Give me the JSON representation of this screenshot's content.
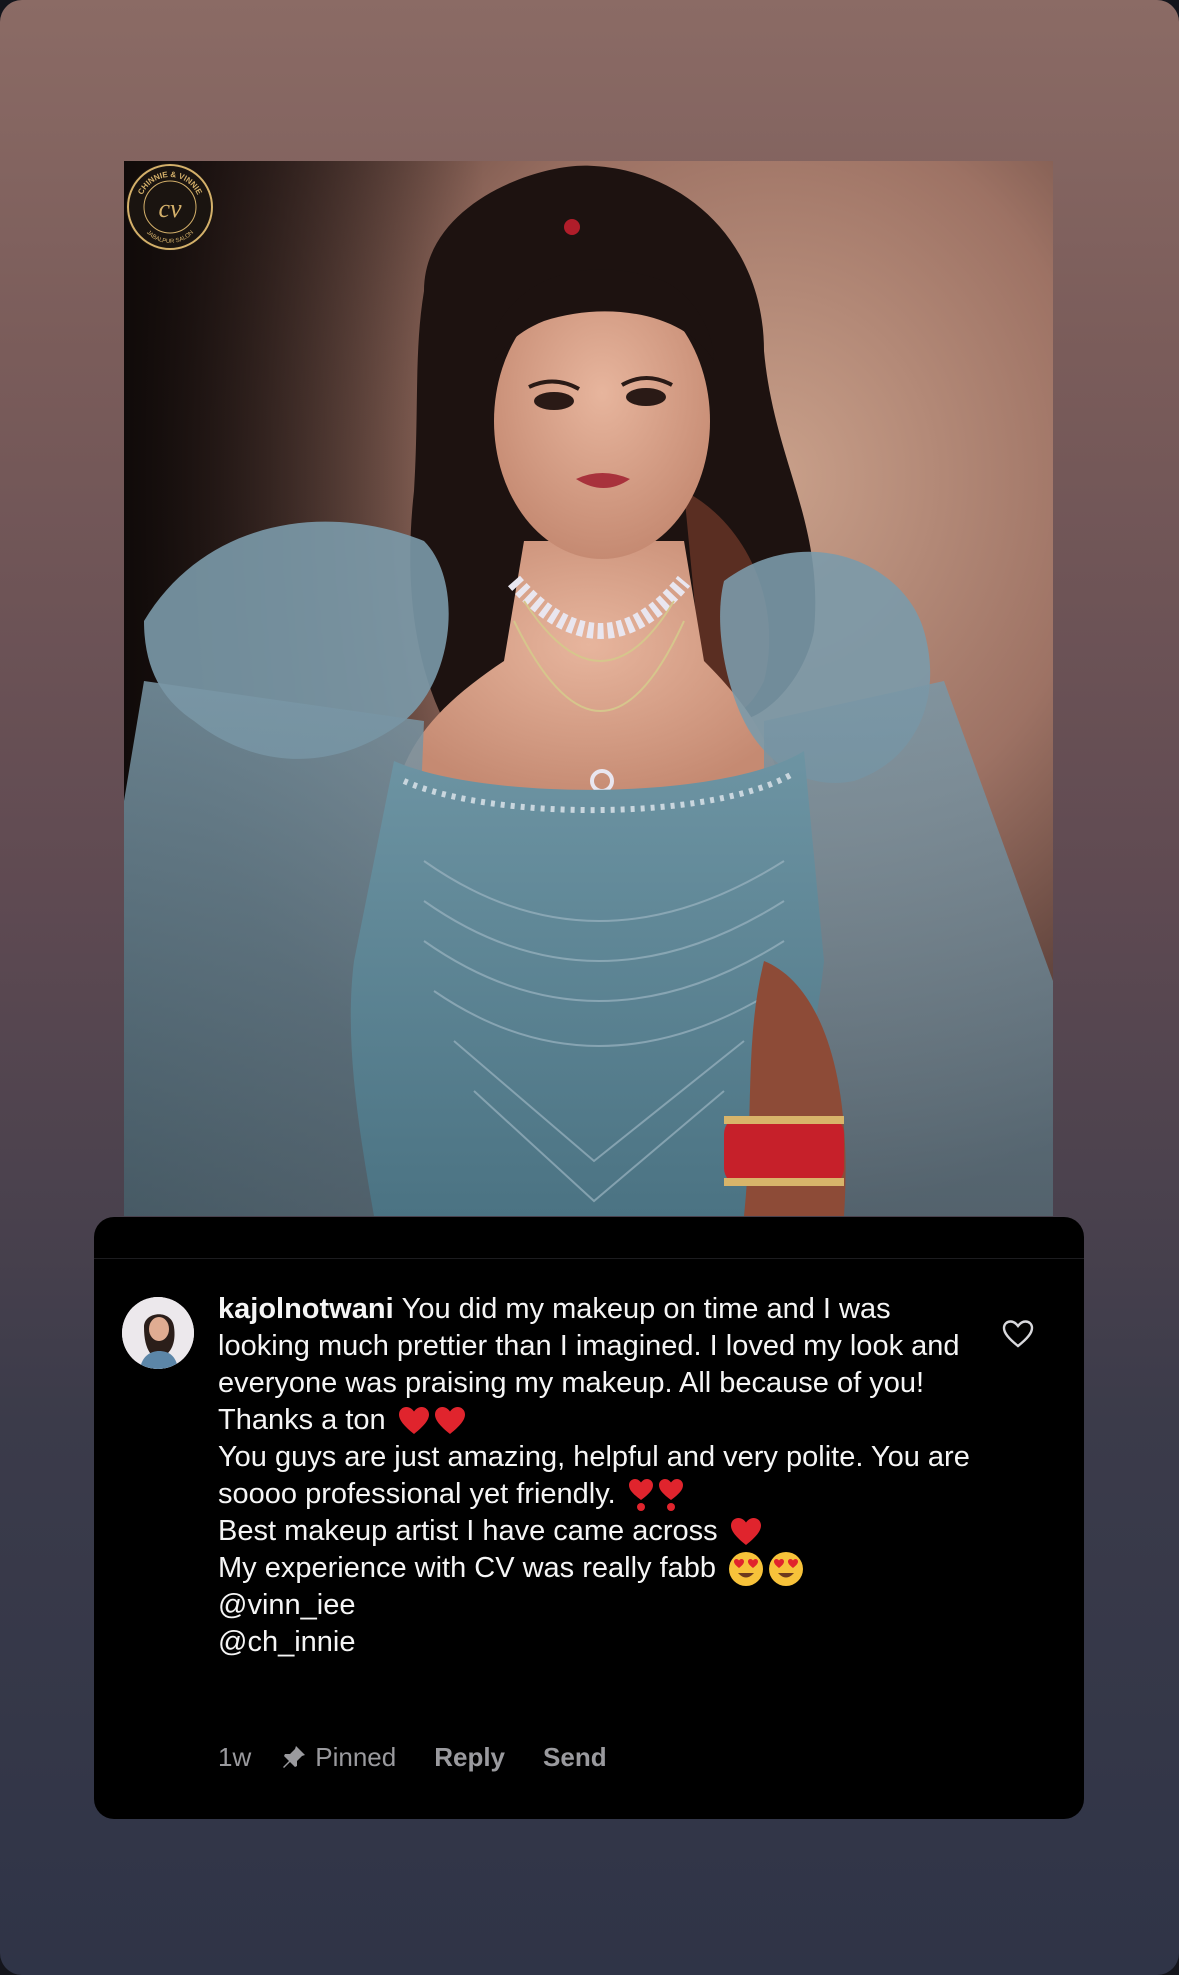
{
  "logo": {
    "top_text": "CHINNIE & VINNIE",
    "monogram": "cv",
    "bottom_text": "JABALPUR SALON"
  },
  "comment": {
    "username": "kajolnotwani",
    "line_1": "You did my makeup on time and I was looking much prettier than I imagined. I loved my look and everyone was praising my makeup. All because of you! Thanks a ton",
    "line_2": "You guys are just amazing, helpful and very polite. You are soooo professional yet friendly.",
    "line_3": "Best makeup artist I have came across",
    "line_4": "My experience with CV was really fabb",
    "mention_1": "@vinn_iee",
    "mention_2": "@ch_innie"
  },
  "meta": {
    "time": "1w",
    "pinned_label": "Pinned",
    "reply_label": "Reply",
    "send_label": "Send"
  },
  "icons": {
    "like": "heart-outline-icon",
    "pin": "pin-icon",
    "emoji_heart": "red-heart-emoji",
    "emoji_exclamation_heart": "heart-exclamation-emoji",
    "emoji_heart_eyes": "heart-eyes-emoji"
  },
  "colors": {
    "card_bg": "#000000",
    "text": "#f5f5f5",
    "muted": "#9a9a9e",
    "heart_red": "#e0242d",
    "dress_blue": "#5f8595"
  }
}
